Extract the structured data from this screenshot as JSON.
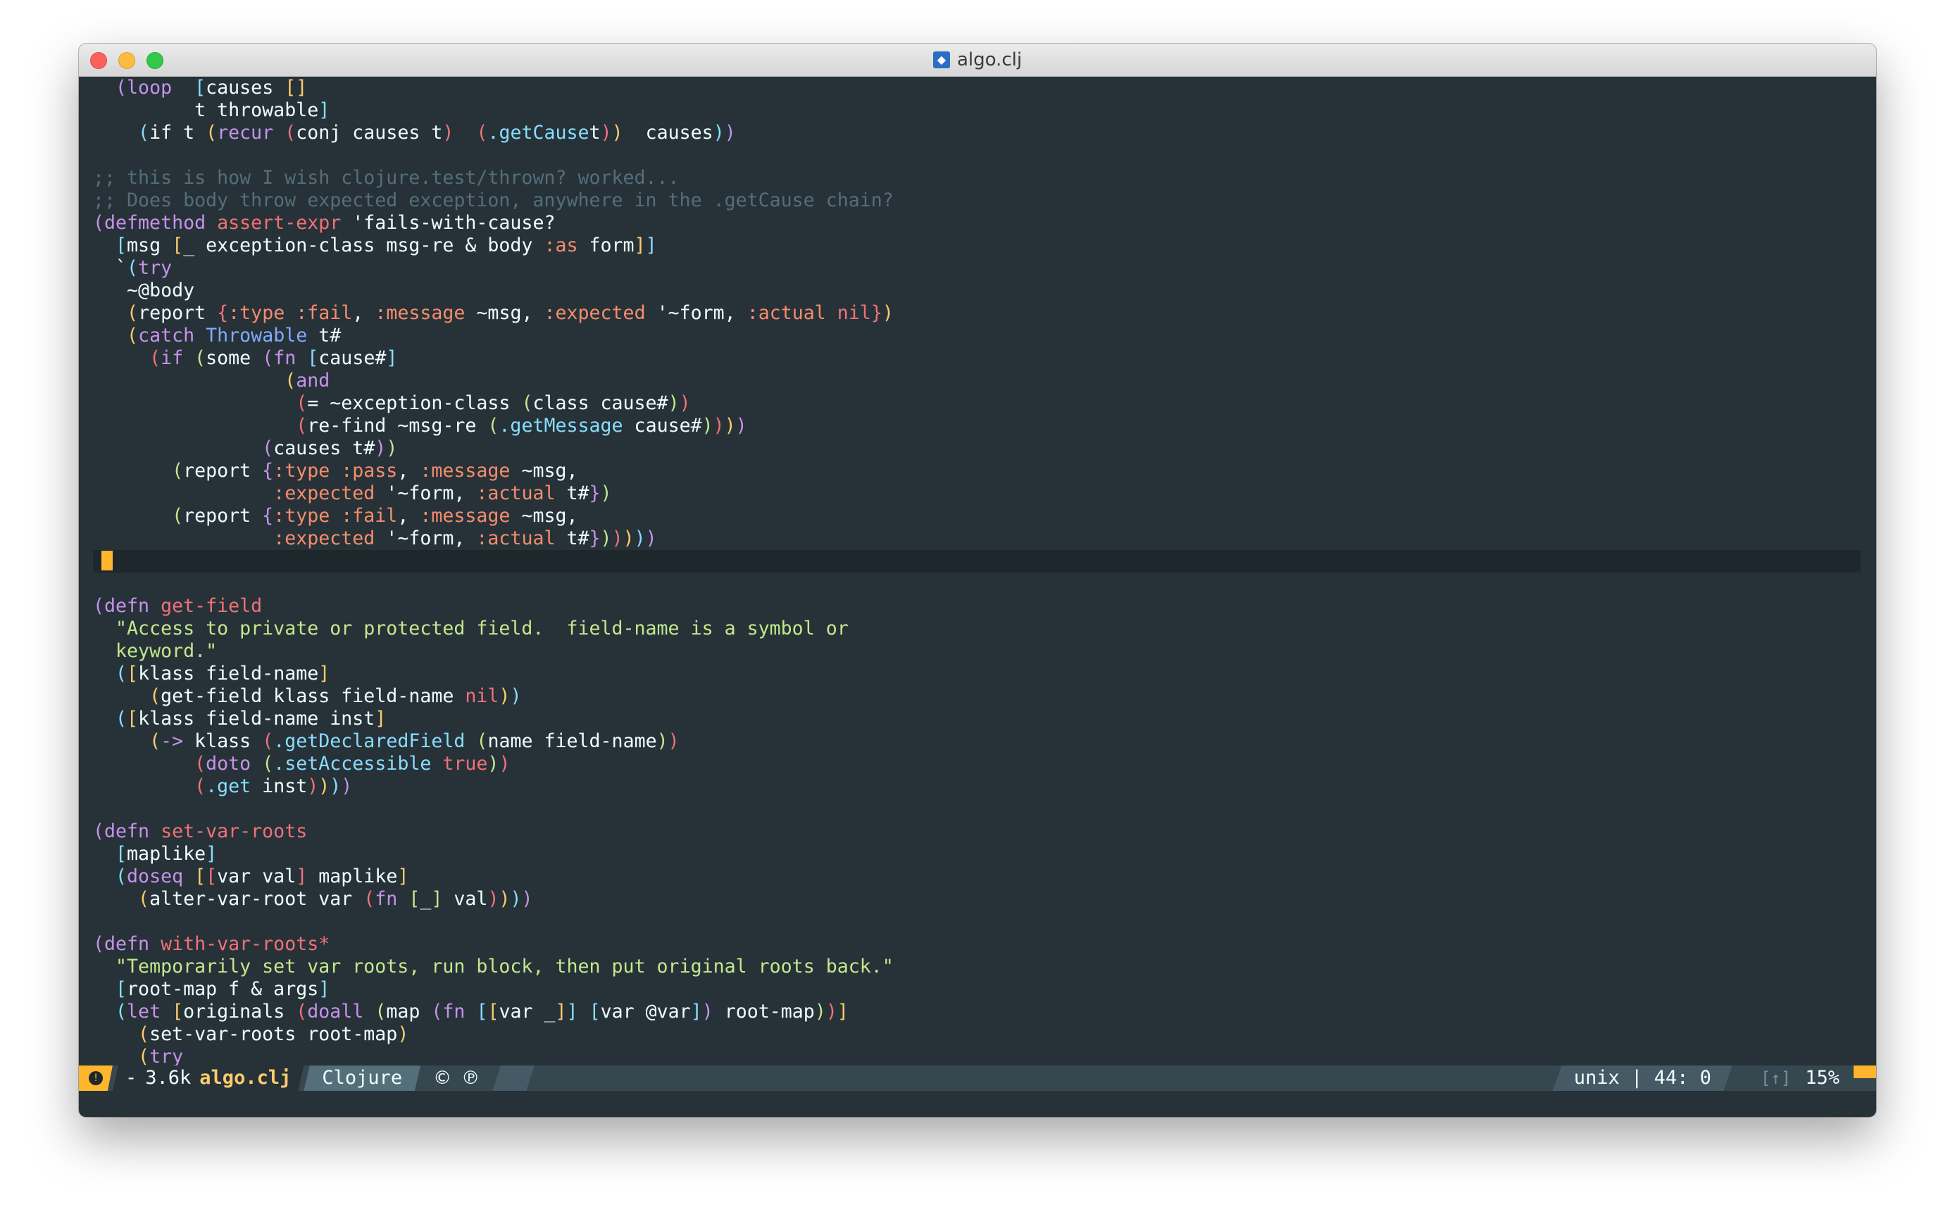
{
  "window": {
    "title": "algo.clj",
    "file_icon_glyph": "◆"
  },
  "code_lines": [
    {
      "indent": "  ",
      "spans": [
        [
          "p1",
          "("
        ],
        [
          "k",
          "loop"
        ],
        [
          "",
          "  "
        ],
        [
          "p2",
          "["
        ],
        [
          "",
          "causes "
        ],
        [
          "p3",
          "[]"
        ]
      ]
    },
    {
      "indent": "         ",
      "spans": [
        [
          "",
          "t throwable"
        ],
        [
          "p2",
          "]"
        ]
      ]
    },
    {
      "indent": "    ",
      "spans": [
        [
          "p2",
          "("
        ],
        [
          "",
          "if t "
        ],
        [
          "p3",
          "("
        ],
        [
          "k",
          "recur "
        ],
        [
          "p4",
          "("
        ],
        [
          "",
          "conj causes t"
        ],
        [
          "p4",
          ")"
        ],
        [
          "",
          "  "
        ],
        [
          "p4",
          "("
        ],
        [
          "m",
          ".getCause"
        ],
        [
          "",
          "",
          " "
        ],
        [
          "",
          "t"
        ],
        [
          "p4",
          ")"
        ],
        [
          "p3",
          ")"
        ],
        [
          "",
          "  causes"
        ],
        [
          "p2",
          ")"
        ],
        [
          "p1",
          ")"
        ]
      ]
    },
    {
      "indent": "",
      "spans": []
    },
    {
      "indent": "",
      "spans": [
        [
          "c",
          ";; this is how I wish clojure.test/thrown? worked..."
        ]
      ]
    },
    {
      "indent": "",
      "spans": [
        [
          "c",
          ";; Does body throw expected exception, anywhere in the .getCause chain?"
        ]
      ]
    },
    {
      "indent": "",
      "spans": [
        [
          "p1",
          "("
        ],
        [
          "k",
          "defmethod "
        ],
        [
          "f",
          "assert-expr "
        ],
        [
          "",
          "'fails-with-cause?"
        ]
      ]
    },
    {
      "indent": "  ",
      "spans": [
        [
          "p2",
          "["
        ],
        [
          "",
          "msg "
        ],
        [
          "p3",
          "["
        ],
        [
          "",
          "_ exception-class msg-re & body "
        ],
        [
          "kw",
          ":as"
        ],
        [
          "",
          " form"
        ],
        [
          "p3",
          "]"
        ],
        [
          "p2",
          "]"
        ]
      ]
    },
    {
      "indent": "  ",
      "spans": [
        [
          "",
          "`"
        ],
        [
          "p2",
          "("
        ],
        [
          "k",
          "try"
        ]
      ]
    },
    {
      "indent": "   ",
      "spans": [
        [
          "",
          "~@body"
        ]
      ]
    },
    {
      "indent": "   ",
      "spans": [
        [
          "p3",
          "("
        ],
        [
          "",
          "report "
        ],
        [
          "p4",
          "{"
        ],
        [
          "kw",
          ":type :fail"
        ],
        [
          "",
          ", "
        ],
        [
          "kw",
          ":message"
        ],
        [
          "",
          " ~msg, "
        ],
        [
          "kw",
          ":expected"
        ],
        [
          "",
          " '~form, "
        ],
        [
          "kw",
          ":actual "
        ],
        [
          "f",
          "nil"
        ],
        [
          "p4",
          "}"
        ],
        [
          "p3",
          ")"
        ]
      ]
    },
    {
      "indent": "   ",
      "spans": [
        [
          "p3",
          "("
        ],
        [
          "k",
          "catch "
        ],
        [
          "t",
          "Throwable"
        ],
        [
          "",
          " t#"
        ]
      ]
    },
    {
      "indent": "     ",
      "spans": [
        [
          "p4",
          "("
        ],
        [
          "k",
          "if "
        ],
        [
          "p5",
          "("
        ],
        [
          "",
          "some "
        ],
        [
          "p1",
          "("
        ],
        [
          "k",
          "fn "
        ],
        [
          "p2",
          "["
        ],
        [
          "",
          "cause#"
        ],
        [
          "p2",
          "]"
        ]
      ]
    },
    {
      "indent": "                 ",
      "spans": [
        [
          "p3",
          "("
        ],
        [
          "k",
          "and"
        ]
      ]
    },
    {
      "indent": "                  ",
      "spans": [
        [
          "p4",
          "("
        ],
        [
          "",
          "= ~exception-class "
        ],
        [
          "p5",
          "("
        ],
        [
          "",
          "class cause#"
        ],
        [
          "p5",
          ")"
        ],
        [
          "p4",
          ")"
        ]
      ]
    },
    {
      "indent": "                  ",
      "spans": [
        [
          "p4",
          "("
        ],
        [
          "",
          "re-find ~msg-re "
        ],
        [
          "p5",
          "("
        ],
        [
          "m",
          ".getMessage"
        ],
        [
          "",
          " cause#"
        ],
        [
          "p5",
          ")"
        ],
        [
          "p4",
          ")"
        ],
        [
          "p3",
          ")"
        ],
        [
          "p1",
          ")"
        ]
      ]
    },
    {
      "indent": "               ",
      "spans": [
        [
          "p1",
          "("
        ],
        [
          "",
          "causes t#"
        ],
        [
          "p1",
          ")"
        ],
        [
          "p5",
          ")"
        ]
      ]
    },
    {
      "indent": "       ",
      "spans": [
        [
          "p5",
          "("
        ],
        [
          "",
          "report "
        ],
        [
          "p1",
          "{"
        ],
        [
          "kw",
          ":type :pass"
        ],
        [
          "",
          ", "
        ],
        [
          "kw",
          ":message"
        ],
        [
          "",
          " ~msg,"
        ]
      ]
    },
    {
      "indent": "                ",
      "spans": [
        [
          "kw",
          ":expected"
        ],
        [
          "",
          " '~form, "
        ],
        [
          "kw",
          ":actual"
        ],
        [
          "",
          " t#"
        ],
        [
          "p1",
          "}"
        ],
        [
          "p5",
          ")"
        ]
      ]
    },
    {
      "indent": "       ",
      "spans": [
        [
          "p5",
          "("
        ],
        [
          "",
          "report "
        ],
        [
          "p1",
          "{"
        ],
        [
          "kw",
          ":type :fail"
        ],
        [
          "",
          ", "
        ],
        [
          "kw",
          ":message"
        ],
        [
          "",
          " ~msg,"
        ]
      ]
    },
    {
      "indent": "                ",
      "spans": [
        [
          "kw",
          ":expected"
        ],
        [
          "",
          " '~form, "
        ],
        [
          "kw",
          ":actual"
        ],
        [
          "",
          " t#"
        ],
        [
          "p1",
          "}"
        ],
        [
          "p5",
          ")"
        ],
        [
          "p4",
          ")"
        ],
        [
          "p3",
          ")"
        ],
        [
          "p2",
          ")"
        ],
        [
          "p1",
          ")"
        ]
      ]
    },
    {
      "indent": "",
      "spans": [],
      "current": true
    },
    {
      "indent": "",
      "spans": []
    },
    {
      "indent": "",
      "spans": [
        [
          "p1",
          "("
        ],
        [
          "k",
          "defn "
        ],
        [
          "f",
          "get-field"
        ]
      ]
    },
    {
      "indent": "  ",
      "spans": [
        [
          "s",
          "\"Access to private or protected field.  field-name is a symbol or"
        ]
      ]
    },
    {
      "indent": "  ",
      "spans": [
        [
          "s",
          "keyword.\""
        ]
      ]
    },
    {
      "indent": "  ",
      "spans": [
        [
          "p2",
          "("
        ],
        [
          "p3",
          "["
        ],
        [
          "",
          "klass field-name"
        ],
        [
          "p3",
          "]"
        ]
      ]
    },
    {
      "indent": "     ",
      "spans": [
        [
          "p3",
          "("
        ],
        [
          "",
          "get-field klass field-name "
        ],
        [
          "f",
          "nil"
        ],
        [
          "p3",
          ")"
        ],
        [
          "p2",
          ")"
        ]
      ]
    },
    {
      "indent": "  ",
      "spans": [
        [
          "p2",
          "("
        ],
        [
          "p3",
          "["
        ],
        [
          "",
          "klass field-name inst"
        ],
        [
          "p3",
          "]"
        ]
      ]
    },
    {
      "indent": "     ",
      "spans": [
        [
          "p3",
          "("
        ],
        [
          "k",
          "-> "
        ],
        [
          "",
          "klass "
        ],
        [
          "p4",
          "("
        ],
        [
          "m",
          ".getDeclaredField"
        ],
        [
          "",
          " "
        ],
        [
          "p5",
          "("
        ],
        [
          "",
          "name field-name"
        ],
        [
          "p5",
          ")"
        ],
        [
          "p4",
          ")"
        ]
      ]
    },
    {
      "indent": "         ",
      "spans": [
        [
          "p4",
          "("
        ],
        [
          "k",
          "doto "
        ],
        [
          "p5",
          "("
        ],
        [
          "m",
          ".setAccessible"
        ],
        [
          "",
          " "
        ],
        [
          "f",
          "true"
        ],
        [
          "p5",
          ")"
        ],
        [
          "p4",
          ")"
        ]
      ]
    },
    {
      "indent": "         ",
      "spans": [
        [
          "p4",
          "("
        ],
        [
          "m",
          ".get"
        ],
        [
          "",
          " inst"
        ],
        [
          "p4",
          ")"
        ],
        [
          "p3",
          ")"
        ],
        [
          "p2",
          ")"
        ],
        [
          "p1",
          ")"
        ]
      ]
    },
    {
      "indent": "",
      "spans": []
    },
    {
      "indent": "",
      "spans": [
        [
          "p1",
          "("
        ],
        [
          "k",
          "defn "
        ],
        [
          "f",
          "set-var-roots"
        ]
      ]
    },
    {
      "indent": "  ",
      "spans": [
        [
          "p2",
          "["
        ],
        [
          "",
          "maplike"
        ],
        [
          "p2",
          "]"
        ]
      ]
    },
    {
      "indent": "  ",
      "spans": [
        [
          "p2",
          "("
        ],
        [
          "k",
          "doseq "
        ],
        [
          "p3",
          "["
        ],
        [
          "p4",
          "["
        ],
        [
          "",
          "var val"
        ],
        [
          "p4",
          "]"
        ],
        [
          "",
          " maplike"
        ],
        [
          "p3",
          "]"
        ]
      ]
    },
    {
      "indent": "    ",
      "spans": [
        [
          "p3",
          "("
        ],
        [
          "",
          "alter-var-root var "
        ],
        [
          "p4",
          "("
        ],
        [
          "k",
          "fn "
        ],
        [
          "p5",
          "["
        ],
        [
          "",
          "_"
        ],
        [
          "p5",
          "]"
        ],
        [
          "",
          " val"
        ],
        [
          "p4",
          ")"
        ],
        [
          "p3",
          ")"
        ],
        [
          "p2",
          ")"
        ],
        [
          "p1",
          ")"
        ]
      ]
    },
    {
      "indent": "",
      "spans": []
    },
    {
      "indent": "",
      "spans": [
        [
          "p1",
          "("
        ],
        [
          "k",
          "defn "
        ],
        [
          "f",
          "with-var-roots*"
        ]
      ]
    },
    {
      "indent": "  ",
      "spans": [
        [
          "s",
          "\"Temporarily set var roots, run block, then put original roots back.\""
        ]
      ]
    },
    {
      "indent": "  ",
      "spans": [
        [
          "p2",
          "["
        ],
        [
          "",
          "root-map f & args"
        ],
        [
          "p2",
          "]"
        ]
      ]
    },
    {
      "indent": "  ",
      "spans": [
        [
          "p2",
          "("
        ],
        [
          "k",
          "let "
        ],
        [
          "p3",
          "["
        ],
        [
          "",
          "originals "
        ],
        [
          "p4",
          "("
        ],
        [
          "k",
          "doall "
        ],
        [
          "p5",
          "("
        ],
        [
          "",
          "map "
        ],
        [
          "p1",
          "("
        ],
        [
          "k",
          "fn "
        ],
        [
          "p2",
          "["
        ],
        [
          "p3",
          "["
        ],
        [
          "",
          "var _"
        ],
        [
          "p3",
          "]"
        ],
        [
          "p2",
          "]"
        ],
        [
          "",
          " "
        ],
        [
          "p2",
          "["
        ],
        [
          "",
          "var @var"
        ],
        [
          "p2",
          "]"
        ],
        [
          "p1",
          ")"
        ],
        [
          "",
          " root-map"
        ],
        [
          "p5",
          ")"
        ],
        [
          "p4",
          ")"
        ],
        [
          "p3",
          "]"
        ]
      ]
    },
    {
      "indent": "    ",
      "spans": [
        [
          "p3",
          "("
        ],
        [
          "",
          "set-var-roots root-map"
        ],
        [
          "p3",
          ")"
        ]
      ]
    },
    {
      "indent": "    ",
      "spans": [
        [
          "p3",
          "("
        ],
        [
          "k",
          "try"
        ]
      ]
    }
  ],
  "modeline": {
    "alert_glyph": "!",
    "buffer_state": "-",
    "buffer_size": "3.6k",
    "file_name": "algo.clj",
    "major_mode": "Clojure",
    "minor_mode_1": "©",
    "minor_mode_2": "℗",
    "encoding_position": "unix | 44: 0",
    "scroll_icon": "[↑]",
    "scroll_percent": "15%"
  },
  "colors": {
    "background": "#263238",
    "comment": "#546e7a",
    "keyword": "#c792ea",
    "function_name": "#f07178",
    "clj_keyword": "#f78c6c",
    "string": "#c3e88d",
    "method": "#89ddff",
    "type": "#82aaff",
    "cursor": "#ffb62c"
  }
}
